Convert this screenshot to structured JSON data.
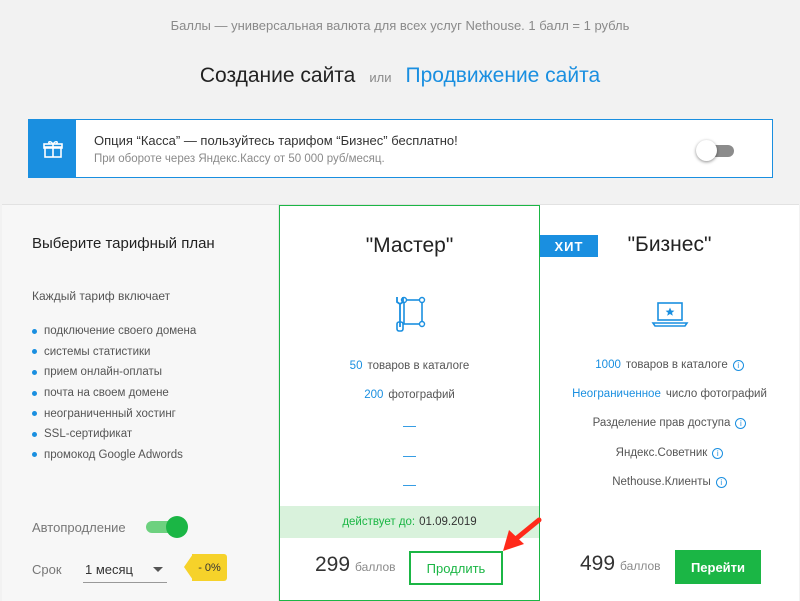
{
  "header": {
    "subtitle": "Баллы — универсальная валюта для всех услуг Nethouse. 1 балл = 1 рубль",
    "tab_create": "Создание сайта",
    "tab_or": "или",
    "tab_promo": "Продвижение сайта"
  },
  "promo": {
    "title": "Опция “Касса” — пользуйтесь тарифом “Бизнес” бесплатно!",
    "subtitle": "При обороте через Яндекс.Кассу от 50 000 руб/месяц.",
    "toggle_on": false,
    "icon": "gift-icon"
  },
  "left": {
    "title": "Выберите тарифный план",
    "includes": "Каждый тариф включает",
    "features": [
      "подключение своего домена",
      "системы статистики",
      "прием онлайн-оплаты",
      "почта на своем домене",
      "неограниченный хостинг",
      "SSL-сертификат",
      "промокод Google Adwords"
    ],
    "autorenew_label": "Автопродление",
    "autorenew_on": true,
    "term_label": "Срок",
    "term_value": "1 месяц",
    "discount": "- 0%"
  },
  "master": {
    "title": "\"Мастер\"",
    "icon": "tools-icon",
    "products_num": "50",
    "products_text": "товаров в каталоге",
    "photos_num": "200",
    "photos_text": "фотографий",
    "dash": "—",
    "active_label": "действует до:",
    "active_date": "01.09.2019",
    "price": "299",
    "price_unit": "баллов",
    "button": "Продлить"
  },
  "business": {
    "badge": "ХИТ",
    "title": "\"Бизнес\"",
    "icon": "laptop-star-icon",
    "products_num": "1000",
    "products_text": "товаров в каталоге",
    "photos_hl": "Неограниченное",
    "photos_text": "число фотографий",
    "access": "Разделение прав доступа",
    "advisor": "Яндекс.Советник",
    "clients": "Nethouse.Клиенты",
    "price": "499",
    "price_unit": "баллов",
    "button": "Перейти"
  },
  "colors": {
    "blue": "#1a8fe0",
    "green": "#1bb645",
    "yellow": "#f6d22a",
    "arrow": "#ff2a1a"
  }
}
